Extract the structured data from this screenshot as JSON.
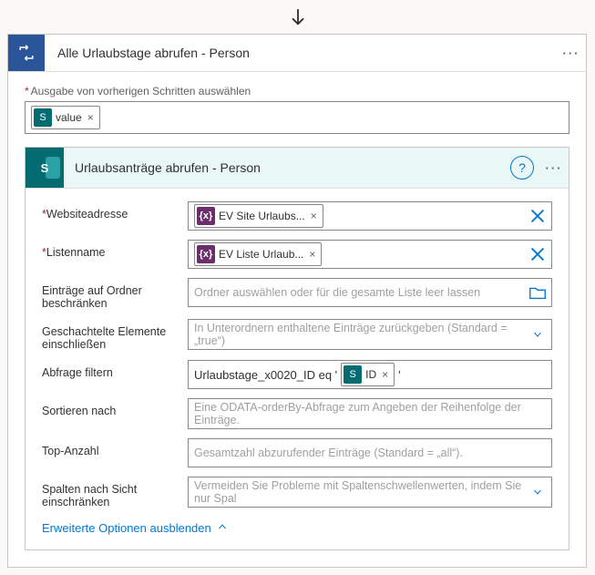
{
  "outer": {
    "title": "Alle Urlaubstage abrufen - Person",
    "prevStepsLabel": "Ausgabe von vorherigen Schritten auswählen",
    "valuePill": "value"
  },
  "inner": {
    "title": "Urlaubsanträge abrufen - Person",
    "rows": {
      "site": {
        "label": "Websiteadresse",
        "pill": "EV Site Urlaubs..."
      },
      "list": {
        "label": "Listenname",
        "pill": "EV Liste Urlaub..."
      },
      "folder": {
        "label": "Einträge auf Ordner beschränken",
        "placeholder": "Ordner auswählen oder für die gesamte Liste leer lassen"
      },
      "nested": {
        "label": "Geschachtelte Elemente einschließen",
        "placeholder": "In Unterordnern enthaltene Einträge zurückgeben (Standard = „true“)"
      },
      "filter": {
        "label": "Abfrage filtern",
        "prefix": "Urlaubstage_x0020_ID eq '",
        "pill": "ID",
        "suffix": " '"
      },
      "sort": {
        "label": "Sortieren nach",
        "placeholder": "Eine ODATA-orderBy-Abfrage zum Angeben der Reihenfolge der Einträge."
      },
      "top": {
        "label": "Top-Anzahl",
        "placeholder": "Gesamtzahl abzurufender Einträge (Standard = „all“)."
      },
      "cols": {
        "label": "Spalten nach Sicht einschränken",
        "placeholder": "Vermeiden Sie Probleme mit Spaltenschwellenwerten, indem Sie nur Spal"
      }
    },
    "advLink": "Erweiterte Optionen ausblenden"
  }
}
